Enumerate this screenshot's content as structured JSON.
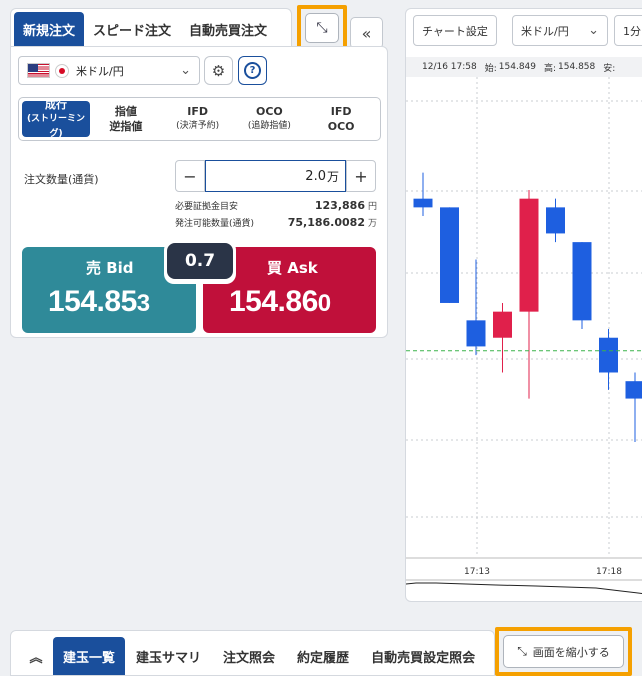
{
  "order_tabs": [
    "新規注文",
    "スピード注文",
    "自動売買注文"
  ],
  "pair": {
    "label": "米ドル/円"
  },
  "order_types": [
    {
      "main": "成行",
      "sub": "(ストリーミング)"
    },
    {
      "main": "指値",
      "sub": "逆指値"
    },
    {
      "main": "IFD",
      "sub": "(決済予約)"
    },
    {
      "main": "OCO",
      "sub": "(追跡指値)"
    },
    {
      "main": "IFD",
      "sub": "OCO"
    }
  ],
  "quantity": {
    "label": "注文数量(通貨)",
    "value": "2.0",
    "unit": "万",
    "minus": "−",
    "plus": "+"
  },
  "margin": {
    "label": "必要証拠金目安",
    "value": "123,886",
    "unit": "円"
  },
  "available": {
    "label": "発注可能数量(通貨)",
    "value": "75,186.0082",
    "unit": "万"
  },
  "bid": {
    "label": "売 Bid",
    "price_main": "154.85",
    "price_small": "3"
  },
  "ask": {
    "label": "買 Ask",
    "price_main": "154.86",
    "price_small": "0"
  },
  "spread": "0.7",
  "chart": {
    "settings_label": "チャート設定",
    "pair_label": "米ドル/円",
    "interval_label": "1分",
    "ohlc": {
      "date": "12/16 17:58",
      "open_label": "始:",
      "open": "154.849",
      "high_label": "高:",
      "high": "154.858",
      "low_label": "安:"
    },
    "time_labels": [
      "17:13",
      "17:18"
    ]
  },
  "chart_data": {
    "type": "candlestick",
    "series": [
      {
        "open": 154.842,
        "high": 154.848,
        "low": 154.838,
        "close": 154.84,
        "color": "#1e5fe0"
      },
      {
        "open": 154.84,
        "high": 154.84,
        "low": 154.818,
        "close": 154.818,
        "color": "#1e5fe0"
      },
      {
        "open": 154.814,
        "high": 154.828,
        "low": 154.806,
        "close": 154.808,
        "color": "#1e5fe0"
      },
      {
        "open": 154.81,
        "high": 154.818,
        "low": 154.802,
        "close": 154.816,
        "color": "#e0204b"
      },
      {
        "open": 154.816,
        "high": 154.844,
        "low": 154.796,
        "close": 154.842,
        "color": "#e0204b"
      },
      {
        "open": 154.84,
        "high": 154.842,
        "low": 154.832,
        "close": 154.834,
        "color": "#1e5fe0"
      },
      {
        "open": 154.832,
        "high": 154.832,
        "low": 154.812,
        "close": 154.814,
        "color": "#1e5fe0"
      },
      {
        "open": 154.81,
        "high": 154.812,
        "low": 154.798,
        "close": 154.802,
        "color": "#1e5fe0"
      },
      {
        "open": 154.8,
        "high": 154.802,
        "low": 154.786,
        "close": 154.796,
        "color": "#1e5fe0"
      }
    ],
    "current_price": 154.807
  },
  "bottom_tabs": [
    "建玉一覧",
    "建玉サマリ",
    "注文照会",
    "約定履歴",
    "自動売買設定照会"
  ],
  "shrink_label": "画面を縮小する"
}
